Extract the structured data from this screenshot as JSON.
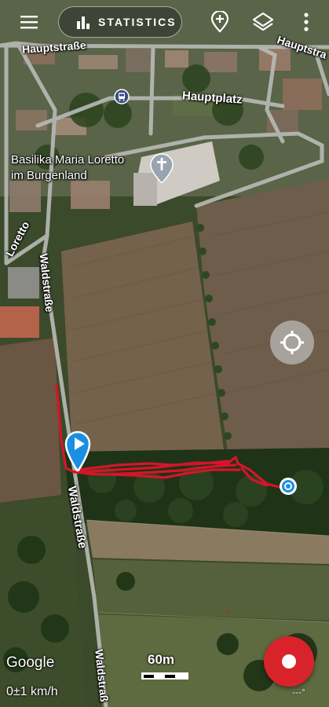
{
  "toolbar": {
    "statistics_label": "STATISTICS",
    "menu_icon": "hamburger-menu-icon",
    "add_marker_icon": "add-marker-icon",
    "layers_icon": "layers-icon",
    "more_icon": "more-vertical-icon"
  },
  "map": {
    "street_labels": {
      "hauptstrasse_left": "Hauptstraße",
      "hauptstrasse_right": "Hauptstra",
      "hauptplatz": "Hauptplatz",
      "loretto": "Loretto",
      "waldstrasse_top": "Waldstraße",
      "waldstrasse_mid": "Waldstraße",
      "waldstrasse_bottom": "Waldstraß"
    },
    "poi": {
      "line1": "Basilika Maria Loretto",
      "line2": "im Burgenland"
    },
    "track_color": "#d4152a",
    "route_color": "#d4152a",
    "start_marker_color": "#1a8fe3"
  },
  "footer": {
    "attribution": "Google",
    "scale_label": "60m",
    "speed": "0±1 km/h",
    "heading": "---°"
  },
  "colors": {
    "record_button": "#d9232b",
    "field_brown": "#6b5a45",
    "forest_green": "#1f3316"
  }
}
